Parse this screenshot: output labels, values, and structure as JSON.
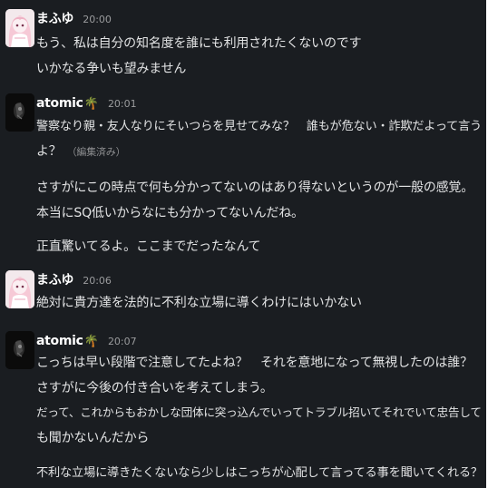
{
  "messages": [
    {
      "name": "まふゆ",
      "time": "20:00",
      "lines": [
        "もう、私は自分の知名度を誰にも利用されたくないのです",
        "いかなる争いも望みません"
      ]
    },
    {
      "name": "atomic",
      "emoji": "🌴",
      "time": "20:01",
      "lines": [
        "警察なり親・友人なりにそいつらを見せてみな？　誰もが危ない・詐欺だよって言う",
        "よ？",
        "さすがにこの時点で何も分かってないのはあり得ないというのが一般の感覚。",
        "本当にSQ低いからなにも分かってないんだね。",
        "正直驚いてるよ。ここまでだったなんて"
      ],
      "edited": "（編集済み）"
    },
    {
      "name": "まふゆ",
      "time": "20:06",
      "lines": [
        "絶対に貴方達を法的に不利な立場に導くわけにはいかない"
      ]
    },
    {
      "name": "atomic",
      "emoji": "🌴",
      "time": "20:07",
      "lines": [
        "こっちは早い段階で注意してたよね？　それを意地になって無視したのは誰？",
        "さすがに今後の付き合いを考えてしまう。",
        "だって、これからもおかしな団体に突っ込んでいってトラブル招いてそれでいて忠告して",
        "も聞かないんだから",
        "不利な立場に導きたくないなら少しはこっちが心配して言ってる事を聞いてくれる？"
      ]
    }
  ],
  "colors": {
    "background": "#1a1d21",
    "text": "#e2e3e4",
    "name": "#ffffff",
    "timestamp": "#9a9b9d"
  }
}
